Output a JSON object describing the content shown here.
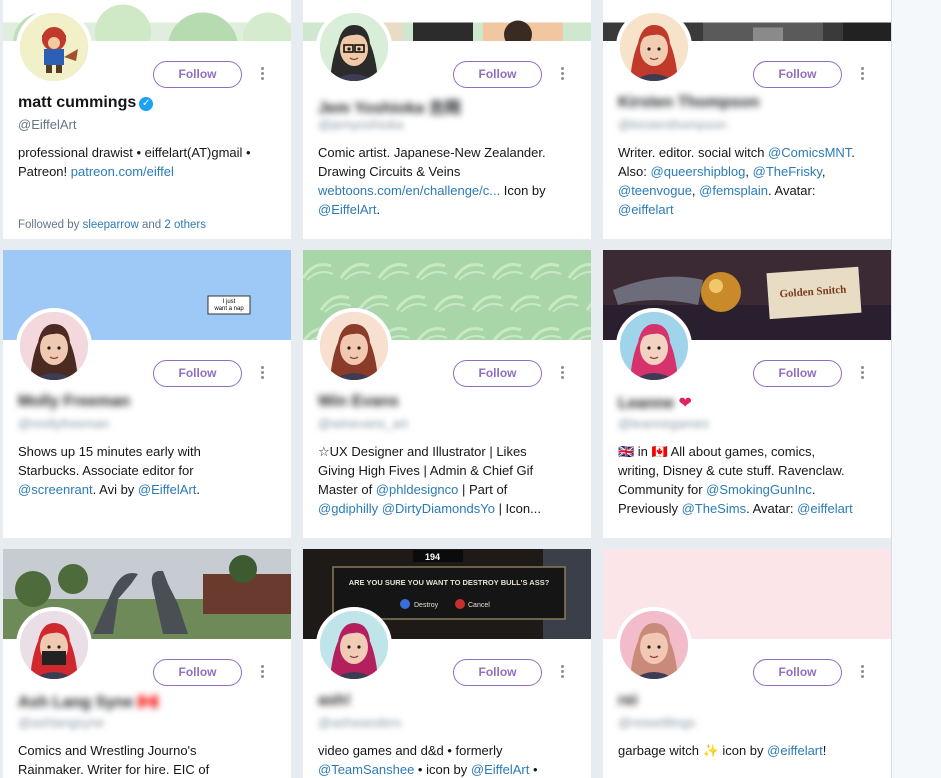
{
  "follow_label": "Follow",
  "accent": "#8e6fc1",
  "link_color": "#2b7bb9",
  "cards": [
    {
      "name": "matt cummings",
      "verified": true,
      "handle": "@EiffelArt",
      "bio": [
        [
          {
            "t": "professional drawist • eiffelart(AT)gmail •"
          }
        ],
        [
          {
            "t": "Patreon! "
          },
          {
            "t": "patreon.com/eiffel",
            "link": true
          }
        ]
      ],
      "followed_by": {
        "prefix": "Followed by ",
        "user": "sleeparrow",
        "mid": " and ",
        "others": "2 others"
      },
      "banner": "green-leaves",
      "avatar": "raccoon"
    },
    {
      "name": "Jem Yoshioka 吉岡",
      "blurred": true,
      "handle": "@jemyoshioka",
      "bio": [
        [
          {
            "t": "Comic artist. Japanese-New Zealander."
          }
        ],
        [
          {
            "t": "Drawing Circuits & Veins"
          }
        ],
        [
          {
            "t": "webtoons.com/en/challenge/c...",
            "link": true
          },
          {
            "t": " Icon by"
          }
        ],
        [
          {
            "t": "@EiffelArt",
            "link": true
          },
          {
            "t": "."
          }
        ]
      ],
      "banner": "comic-art",
      "avatar": "glasses-boy"
    },
    {
      "name": "Kirsten Thompson",
      "blurred": true,
      "handle": "@kirstenthompson",
      "bio": [
        [
          {
            "t": "Writer. editor. social witch "
          },
          {
            "t": "@ComicsMNT",
            "link": true
          },
          {
            "t": "."
          }
        ],
        [
          {
            "t": "Also: "
          },
          {
            "t": "@queershipblog",
            "link": true
          },
          {
            "t": ", "
          },
          {
            "t": "@TheFrisky",
            "link": true
          },
          {
            "t": ","
          }
        ],
        [
          {
            "t": "@teenvogue",
            "link": true
          },
          {
            "t": ", "
          },
          {
            "t": "@femsplain",
            "link": true
          },
          {
            "t": ". Avatar:"
          }
        ],
        [
          {
            "t": "@eiffelart",
            "link": true
          }
        ]
      ],
      "banner": "dark-photo",
      "avatar": "redhead"
    },
    {
      "name": "Molly Freeman",
      "blurred": true,
      "handle": "@mollyfreeman",
      "bio": [
        [
          {
            "t": "Shows up 15 minutes early with"
          }
        ],
        [
          {
            "t": "Starbucks. Associate editor for"
          }
        ],
        [
          {
            "t": "@screenrant",
            "link": true
          },
          {
            "t": ". Avi by "
          },
          {
            "t": "@EiffelArt",
            "link": true
          },
          {
            "t": "."
          }
        ]
      ],
      "banner": "blue-sign",
      "banner_text": [
        "I just",
        "want a nap"
      ],
      "avatar": "brunette"
    },
    {
      "name": "Win Evans",
      "blurred": true,
      "handle": "@winevans_art",
      "bio": [
        [
          {
            "t": "☆UX Designer and Illustrator | Likes"
          }
        ],
        [
          {
            "t": "Giving High Fives | Admin & Chief Gif"
          }
        ],
        [
          {
            "t": "Master of "
          },
          {
            "t": "@phldesignco",
            "link": true
          },
          {
            "t": " | Part of"
          }
        ],
        [
          {
            "t": "@gdiphilly",
            "link": true
          },
          {
            "t": " "
          },
          {
            "t": "@DirtyDiamondsYo",
            "link": true
          },
          {
            "t": " | Icon..."
          }
        ]
      ],
      "banner": "palm-pattern",
      "avatar": "auburn"
    },
    {
      "name": "Leanne",
      "blurred": true,
      "heart": true,
      "handle": "@leannegames",
      "bio": [
        [
          {
            "t": "🇬🇧 in 🇨🇦 All about games, comics,"
          }
        ],
        [
          {
            "t": "writing, Disney & cute stuff. Ravenclaw."
          }
        ],
        [
          {
            "t": "Community for "
          },
          {
            "t": "@SmokingGunInc",
            "link": true
          },
          {
            "t": "."
          }
        ],
        [
          {
            "t": "Previously "
          },
          {
            "t": "@TheSims",
            "link": true
          },
          {
            "t": ". Avatar: "
          },
          {
            "t": "@eiffelart",
            "link": true
          }
        ]
      ],
      "banner": "snitch-photo",
      "avatar": "pink-hair"
    },
    {
      "name": "Ash Lang Syne 🇨🇦",
      "blurred": true,
      "handle": "@ashlangsyne",
      "bio": [
        [
          {
            "t": "Comics and Wrestling Journo's"
          }
        ],
        [
          {
            "t": "Rainmaker. Writer for hire. EIC of"
          }
        ]
      ],
      "banner": "dino-photo",
      "avatar": "mask-red"
    },
    {
      "name": "ash!",
      "blurred": true,
      "handle": "@ashwanders",
      "bio": [
        [
          {
            "t": "video games and d&d • formerly"
          }
        ],
        [
          {
            "t": "@TeamSanshee",
            "link": true
          },
          {
            "t": " • icon by "
          },
          {
            "t": "@EiffelArt",
            "link": true
          },
          {
            "t": " •"
          }
        ]
      ],
      "banner": "game-dialog",
      "banner_text": [
        "194",
        "ARE YOU SURE YOU WANT TO DESTROY BULL'S ASS?",
        "Destroy",
        "Cancel"
      ],
      "avatar": "magenta-hair"
    },
    {
      "name": "rei",
      "blurred": true,
      "handle": "@reiweltlings",
      "bio": [
        [
          {
            "t": "garbage witch ✨ icon by "
          },
          {
            "t": "@eiffelart",
            "link": true
          },
          {
            "t": "!"
          }
        ]
      ],
      "banner": "pink-solid",
      "avatar": "shaved"
    }
  ]
}
